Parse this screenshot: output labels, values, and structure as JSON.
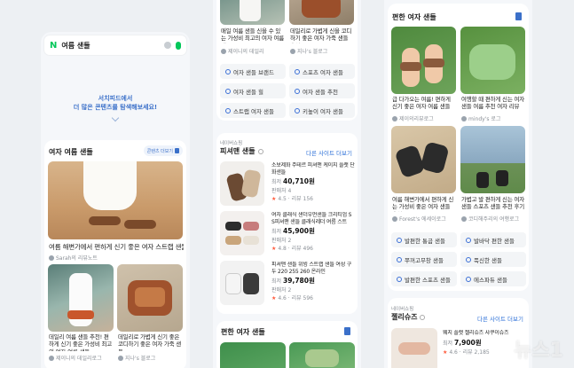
{
  "search": {
    "logo": "N",
    "query": "여름 샌들"
  },
  "banner": {
    "line1": "서치피드에서",
    "line2": "더 많은 콘텐츠를 탐색해보세요!"
  },
  "col1": {
    "title": "여자 여름 샌들",
    "mag_btn": "콘텐츠 더보기",
    "card_main": {
      "text": "여름 해변가에서 편하게 신기 좋은 여자 스트랩 샌들 내돈내산",
      "author": "Sarah의 리뷰노트"
    },
    "card_a": {
      "text": "데일리 여름 샌들 추천! 편하게 신기 좋은 가성비 최고의 여자 여름 샌들",
      "author": "제이니의 데일리로그"
    },
    "card_b": {
      "text": "데일리로 가볍게 신기 좋은 코디하기 좋은 여자 가죽 샌들",
      "author": "지나's 블로그"
    }
  },
  "col2": {
    "top_a": {
      "text": "매일 여름 샌들 신을 수 있는 가성비 최고의 여자 여름 샌들",
      "author": "제이니의 데일리"
    },
    "top_b": {
      "text": "데일리로 가볍게 신을 코디하기 좋은 여자 가죽 샌들 추천",
      "author": "지나's 블로그"
    },
    "chips": [
      "여자 샌들 브랜드",
      "스포츠 여자 샌들",
      "여자 샌들 힐",
      "여자 샌들 추천",
      "스트랩 여자 샌들",
      "키높이 여자 샌들"
    ],
    "shop": {
      "brand": "네이버쇼핑",
      "title": "피셔맨 샌들",
      "more": "다른 사이트 더보기",
      "items": [
        {
          "name": "소보제화 주테르 피셔맨 케이지 플랫 단화샌들",
          "price_label": "최저",
          "price": "40,710원",
          "extra": "판매처 4",
          "rating": "4.5",
          "reviews": "리뷰 156"
        },
        {
          "name": "여자 클래식 샌더우먼샌들 크리티엄 S S피셔맨 샌들 클래식레더 여름 스트",
          "price_label": "최저",
          "price": "45,900원",
          "extra": "판매처 2",
          "rating": "4.8",
          "reviews": "리뷰 496"
        },
        {
          "name": "피셔맨 샌들 위빙 스트랩 샌들 여성 구두 220 255 260 온라인",
          "price_label": "최저",
          "price": "39,780원",
          "extra": "판매처 2",
          "rating": "4.6",
          "reviews": "리뷰 596"
        }
      ]
    },
    "bottom_title": "편한 여자 샌들"
  },
  "col3": {
    "title": "편한 여자 샌들",
    "card_a": {
      "text": "급 다가오는 여름! 편하게 신기 좋은 여자 여름 샌들",
      "author": "제이의리뷰로그"
    },
    "card_b": {
      "text": "여행할 때 편하게 신는 여자 샌들 여름 추천 여자 리뷰",
      "author": "mindy's 로그"
    },
    "card_c": {
      "text": "여름 해변가에서 편하게 신는 가성비 좋은 여자 샌들 추천",
      "author": "Forest's 에세이로그"
    },
    "card_d": {
      "text": "가볍고 발 편하게 신는 여자 샌들 스포츠 샌들 추천 후기",
      "author": "코디해주리의 여행로그"
    },
    "chips": [
      "발편한 통굽 샌들",
      "발바닥 편한 샌들",
      "쭈꺼고무창 샌들",
      "푹신한 샌들",
      "발편한 스포츠 샌들",
      "에스파듀 샌들"
    ],
    "shop": {
      "brand": "네이버쇼핑",
      "title": "젤리슈즈",
      "more": "다른 사이트 더보기",
      "item": {
        "name": "웨지 플랫 젤리슈즈 샤쿠이슈즈",
        "price_label": "최저",
        "price": "7,900원",
        "rating": "4.6",
        "reviews": "리뷰 2,185"
      }
    }
  },
  "watermark": "뉴스1"
}
